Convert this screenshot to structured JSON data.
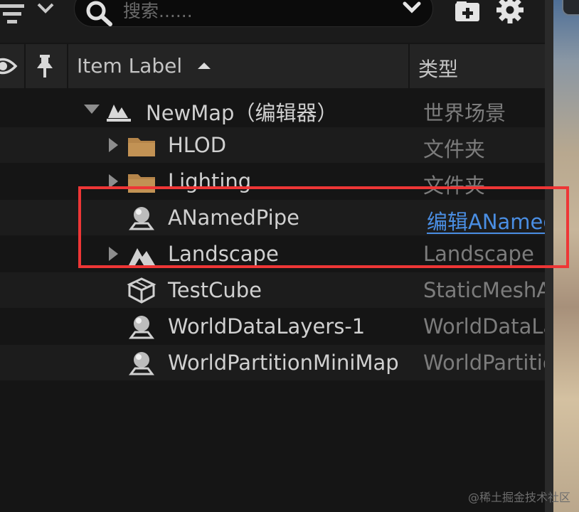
{
  "search": {
    "placeholder": "搜索......"
  },
  "header": {
    "item_label": "Item Label",
    "type_label": "类型"
  },
  "rows": [
    {
      "label": "NewMap（编辑器）",
      "type": "世界场景",
      "icon": "map-icon",
      "expander": "expanded"
    },
    {
      "label": "HLOD",
      "type": "文件夹",
      "icon": "folder-icon",
      "expander": "collapsed"
    },
    {
      "label": "Lighting",
      "type": "文件夹",
      "icon": "folder-icon",
      "expander": "collapsed"
    },
    {
      "label": "ANamedPipe",
      "type": "编辑ANamedPipe",
      "icon": "actor-sphere-icon",
      "expander": "none"
    },
    {
      "label": "Landscape",
      "type": "Landscape",
      "icon": "landscape-icon",
      "expander": "collapsed"
    },
    {
      "label": "TestCube",
      "type": "StaticMeshActor",
      "icon": "static-mesh-icon",
      "expander": "none"
    },
    {
      "label": "WorldDataLayers-1",
      "type": "WorldDataLayers",
      "icon": "actor-sphere-icon",
      "expander": "none"
    },
    {
      "label": "WorldPartitionMiniMap",
      "type": "WorldPartitionMiniMap",
      "icon": "actor-sphere-icon",
      "expander": "none"
    }
  ],
  "colors": {
    "highlight": "#ee3636",
    "link": "#4a8ee3",
    "folder": "#b5854a"
  },
  "watermark": "@稀土掘金技术社区"
}
